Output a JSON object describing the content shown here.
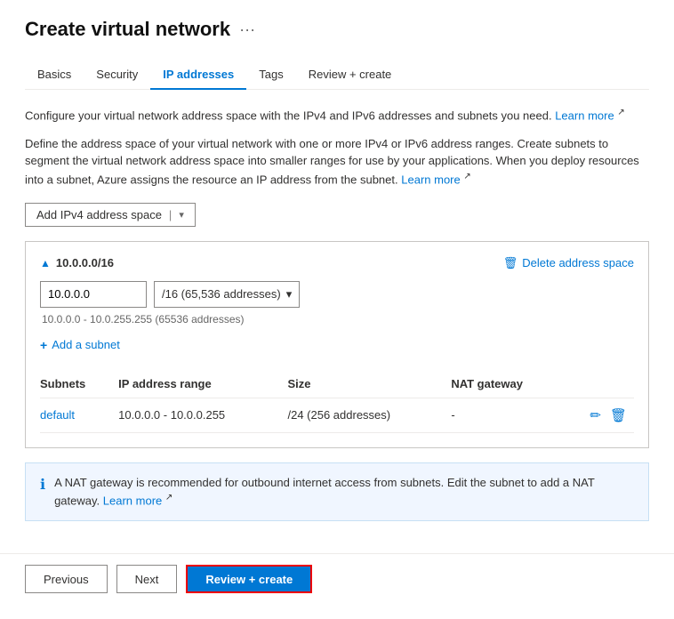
{
  "page": {
    "title": "Create virtual network",
    "more_label": "···"
  },
  "tabs": [
    {
      "id": "basics",
      "label": "Basics",
      "active": false
    },
    {
      "id": "security",
      "label": "Security",
      "active": false
    },
    {
      "id": "ip-addresses",
      "label": "IP addresses",
      "active": true
    },
    {
      "id": "tags",
      "label": "Tags",
      "active": false
    },
    {
      "id": "review-create",
      "label": "Review + create",
      "active": false
    }
  ],
  "descriptions": {
    "line1": "Configure your virtual network address space with the IPv4 and IPv6 addresses and subnets you need.",
    "line1_link": "Learn more",
    "line2": "Define the address space of your virtual network with one or more IPv4 or IPv6 address ranges. Create subnets to segment the virtual network address space into smaller ranges for use by your applications. When you deploy resources into a subnet, Azure assigns the resource an IP address from the subnet.",
    "line2_link": "Learn more"
  },
  "add_ipv4_label": "Add IPv4 address space",
  "address_space": {
    "cidr": "10.0.0.0/16",
    "ip_value": "10.0.0.0",
    "cidr_value": "/16 (65,536 addresses)",
    "range_hint": "10.0.0.0 - 10.0.255.255 (65536 addresses)",
    "delete_label": "Delete address space",
    "add_subnet_label": "Add a subnet"
  },
  "table": {
    "columns": [
      "Subnets",
      "IP address range",
      "Size",
      "NAT gateway"
    ],
    "rows": [
      {
        "name": "default",
        "ip_range": "10.0.0.0 - 10.0.0.255",
        "size": "/24 (256 addresses)",
        "nat_gateway": "-"
      }
    ]
  },
  "info_bar": {
    "text": "A NAT gateway is recommended for outbound internet access from subnets. Edit the subnet to add a NAT gateway.",
    "link_label": "Learn more"
  },
  "buttons": {
    "previous": "Previous",
    "next": "Next",
    "review_create": "Review + create"
  }
}
